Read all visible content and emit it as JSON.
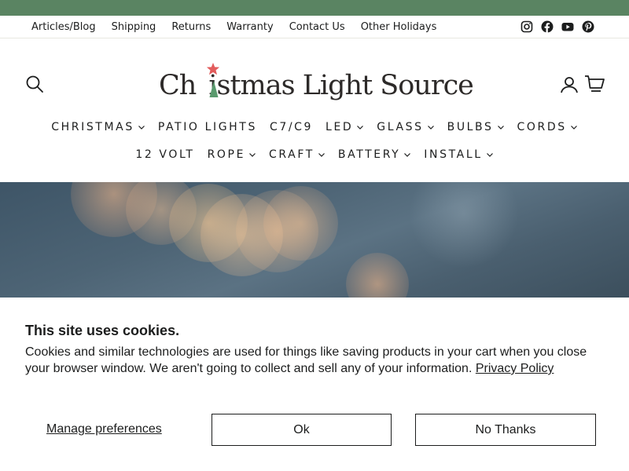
{
  "toolbar": {
    "links": [
      "Articles/Blog",
      "Shipping",
      "Returns",
      "Warranty",
      "Contact Us",
      "Other Holidays"
    ],
    "socials": [
      "instagram-icon",
      "facebook-icon",
      "youtube-icon",
      "pinterest-icon"
    ]
  },
  "header": {
    "logo_text": "Christmas Light Source",
    "logo_pre": "Ch",
    "logo_post": "istmas Light Source",
    "icons": [
      "search-icon",
      "account-icon",
      "cart-icon"
    ]
  },
  "nav": {
    "row1": [
      {
        "label": "CHRISTMAS",
        "dropdown": true
      },
      {
        "label": "PATIO LIGHTS",
        "dropdown": false
      },
      {
        "label": "C7/C9",
        "dropdown": false
      },
      {
        "label": "LED",
        "dropdown": true
      },
      {
        "label": "GLASS",
        "dropdown": true
      },
      {
        "label": "BULBS",
        "dropdown": true
      },
      {
        "label": "CORDS",
        "dropdown": true
      }
    ],
    "row2": [
      {
        "label": "12 VOLT",
        "dropdown": false
      },
      {
        "label": "ROPE",
        "dropdown": true
      },
      {
        "label": "CRAFT",
        "dropdown": true
      },
      {
        "label": "BATTERY",
        "dropdown": true
      },
      {
        "label": "INSTALL",
        "dropdown": true
      }
    ]
  },
  "cookie": {
    "title": "This site uses cookies.",
    "body": "Cookies and similar technologies are used for things like saving products in your cart when you close your browser window. We aren't going to collect and sell any of your information.",
    "privacy_link": "Privacy Policy",
    "manage_label": "Manage preferences",
    "ok_label": "Ok",
    "no_label": "No Thanks"
  },
  "colors": {
    "announce_bar": "#5a8462",
    "logo_star": "#e25c5c",
    "logo_tree": "#5a9a6e",
    "text": "#1c1d1d"
  }
}
